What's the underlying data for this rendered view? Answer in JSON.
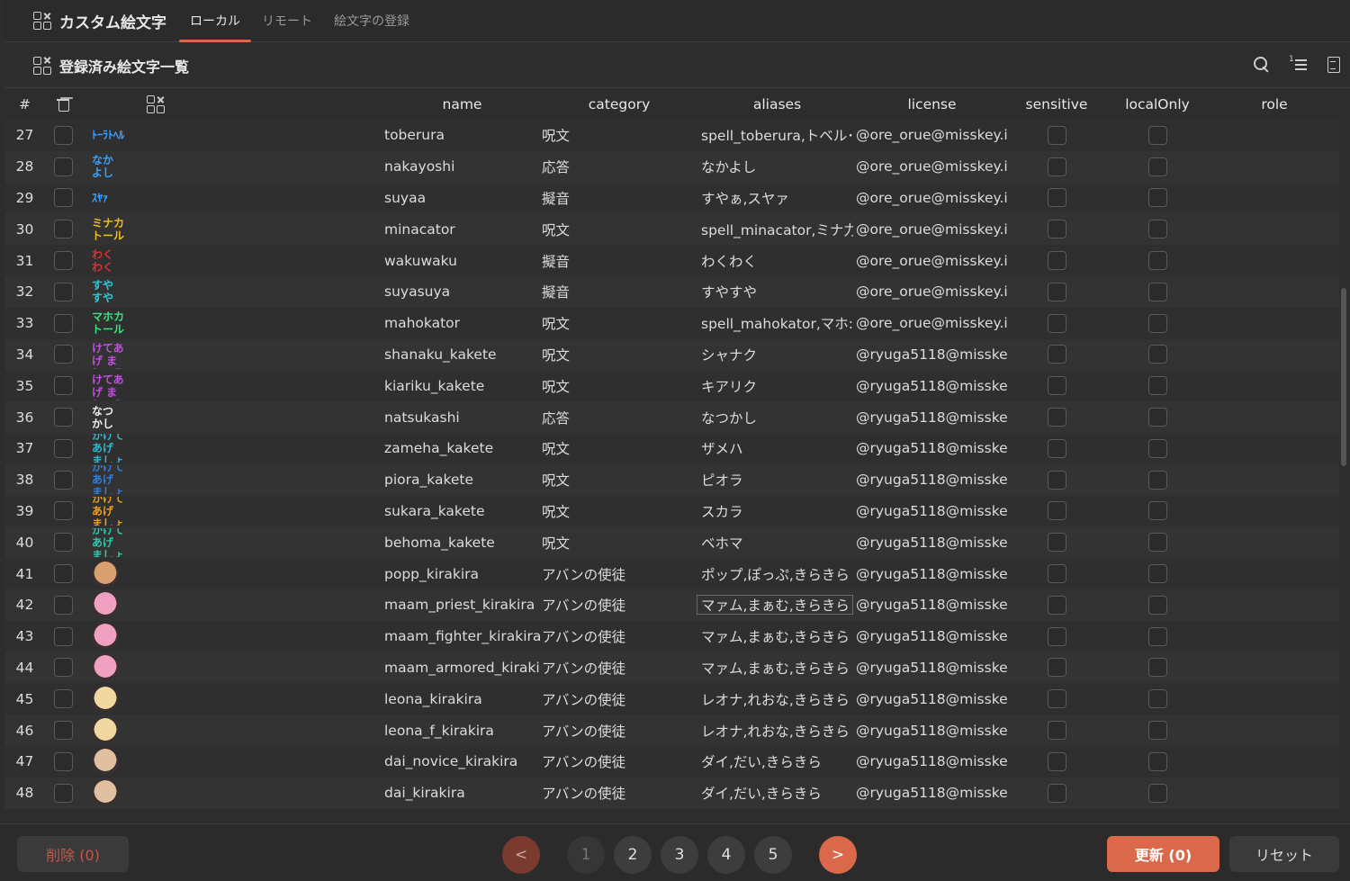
{
  "app": {
    "title": "カスタム絵文字",
    "tabs": [
      {
        "label": "ローカル",
        "active": true
      },
      {
        "label": "リモート",
        "active": false
      },
      {
        "label": "絵文字の登録",
        "active": false
      }
    ]
  },
  "section": {
    "title": "登録済み絵文字一覧",
    "tools": [
      "search-icon",
      "sort-list-icon",
      "document-icon"
    ]
  },
  "table": {
    "columns": {
      "num": "#",
      "name": "name",
      "category": "category",
      "aliases": "aliases",
      "license": "license",
      "sensitive": "sensitive",
      "localOnly": "localOnly",
      "role": "role"
    },
    "rows": [
      {
        "num": "27",
        "thumb": "ﾄｰﾗﾄﾍﾙ",
        "thumb_color": "#3aa0ff",
        "name": "toberura",
        "category": "呪文",
        "aliases": "spell_toberura,トベル･",
        "license": "@ore_orue@misskey.i"
      },
      {
        "num": "28",
        "thumb": "なか よし",
        "thumb_color": "#3aa0ff",
        "name": "nakayoshi",
        "category": "応答",
        "aliases": "なかよし",
        "license": "@ore_orue@misskey.i"
      },
      {
        "num": "29",
        "thumb": "ｽﾔｧ",
        "thumb_color": "#3aa0ff",
        "name": "suyaa",
        "category": "擬音",
        "aliases": "すやぁ,スヤァ",
        "license": "@ore_orue@misskey.i"
      },
      {
        "num": "30",
        "thumb": "ミナカ トール",
        "thumb_color": "#f0c020",
        "name": "minacator",
        "category": "呪文",
        "aliases": "spell_minacator,ミナ力",
        "license": "@ore_orue@misskey.i"
      },
      {
        "num": "31",
        "thumb": "わく わく",
        "thumb_color": "#e03030",
        "name": "wakuwaku",
        "category": "擬音",
        "aliases": "わくわく",
        "license": "@ore_orue@misskey.i"
      },
      {
        "num": "32",
        "thumb": "すや すや",
        "thumb_color": "#30c8d8",
        "name": "suyasuya",
        "category": "擬音",
        "aliases": "すやすや",
        "license": "@ore_orue@misskey.i"
      },
      {
        "num": "33",
        "thumb": "マホカ トール",
        "thumb_color": "#40e080",
        "name": "mahokator",
        "category": "呪文",
        "aliases": "spell_mahokator,マホ:",
        "license": "@ore_orue@misskey.i"
      },
      {
        "num": "34",
        "thumb": "シャナク かけてあげ ましょうね",
        "thumb_color": "#c050e0",
        "name": "shanaku_kakete",
        "category": "呪文",
        "aliases": "シャナク",
        "license": "@ryuga5118@misske"
      },
      {
        "num": "35",
        "thumb": "キアリク かけてあげ ましょうね",
        "thumb_color": "#c050e0",
        "name": "kiariku_kakete",
        "category": "呪文",
        "aliases": "キアリク",
        "license": "@ryuga5118@misske"
      },
      {
        "num": "36",
        "thumb": "なつ かし",
        "thumb_color": "#f0f0f0",
        "name": "natsukashi",
        "category": "応答",
        "aliases": "なつかし",
        "license": "@ryuga5118@misske"
      },
      {
        "num": "37",
        "thumb": "ザメハ かけてあげ ましょうね",
        "thumb_color": "#30b8d0",
        "name": "zameha_kakete",
        "category": "呪文",
        "aliases": "ザメハ",
        "license": "@ryuga5118@misske"
      },
      {
        "num": "38",
        "thumb": "ピオラ かけてあげ ましょうね",
        "thumb_color": "#3080e0",
        "name": "piora_kakete",
        "category": "呪文",
        "aliases": "ピオラ",
        "license": "@ryuga5118@misske"
      },
      {
        "num": "39",
        "thumb": "スカラ かけてあげ ましょうね",
        "thumb_color": "#f0a020",
        "name": "sukara_kakete",
        "category": "呪文",
        "aliases": "スカラ",
        "license": "@ryuga5118@misske"
      },
      {
        "num": "40",
        "thumb": "ベホマ かけてあげ ましょうね",
        "thumb_color": "#30c8b0",
        "name": "behoma_kakete",
        "category": "呪文",
        "aliases": "ベホマ",
        "license": "@ryuga5118@misske"
      },
      {
        "num": "41",
        "thumb": "",
        "thumb_color": "#d8a070",
        "name": "popp_kirakira",
        "category": "アバンの使徒",
        "aliases": "ポップ,ぽっぷ,きらきら",
        "license": "@ryuga5118@misske"
      },
      {
        "num": "42",
        "thumb": "",
        "thumb_color": "#f0a0c0",
        "name": "maam_priest_kirakira",
        "category": "アバンの使徒",
        "aliases": "マァム,まぁむ,きらきら",
        "license": "@ryuga5118@misske"
      },
      {
        "num": "43",
        "thumb": "",
        "thumb_color": "#f0a0c0",
        "name": "maam_fighter_kirakira",
        "category": "アバンの使徒",
        "aliases": "マァム,まぁむ,きらきら",
        "license": "@ryuga5118@misske"
      },
      {
        "num": "44",
        "thumb": "",
        "thumb_color": "#f0a0c0",
        "name": "maam_armored_kirakira",
        "category": "アバンの使徒",
        "aliases": "マァム,まぁむ,きらきら",
        "license": "@ryuga5118@misske"
      },
      {
        "num": "45",
        "thumb": "",
        "thumb_color": "#f0d8a0",
        "name": "leona_kirakira",
        "category": "アバンの使徒",
        "aliases": "レオナ,れおな,きらきら",
        "license": "@ryuga5118@misske"
      },
      {
        "num": "46",
        "thumb": "",
        "thumb_color": "#f0d8a0",
        "name": "leona_f_kirakira",
        "category": "アバンの使徒",
        "aliases": "レオナ,れおな,きらきら",
        "license": "@ryuga5118@misske"
      },
      {
        "num": "47",
        "thumb": "",
        "thumb_color": "#e0c0a0",
        "name": "dai_novice_kirakira",
        "category": "アバンの使徒",
        "aliases": "ダイ,だい,きらきら",
        "license": "@ryuga5118@misske"
      },
      {
        "num": "48",
        "thumb": "",
        "thumb_color": "#e0c0a0",
        "name": "dai_kirakira",
        "category": "アバンの使徒",
        "aliases": "ダイ,だい,きらきら",
        "license": "@ryuga5118@misske"
      }
    ]
  },
  "footer": {
    "delete_label": "削除 (0)",
    "update_label": "更新 (0)",
    "reset_label": "リセット",
    "pager": {
      "prev": "<",
      "next": ">",
      "pages": [
        "1",
        "2",
        "3",
        "4",
        "5"
      ],
      "current": "1"
    }
  },
  "colors": {
    "accent": "#d9694a",
    "background": "#2d2d2d",
    "text": "#dcdcdc"
  }
}
